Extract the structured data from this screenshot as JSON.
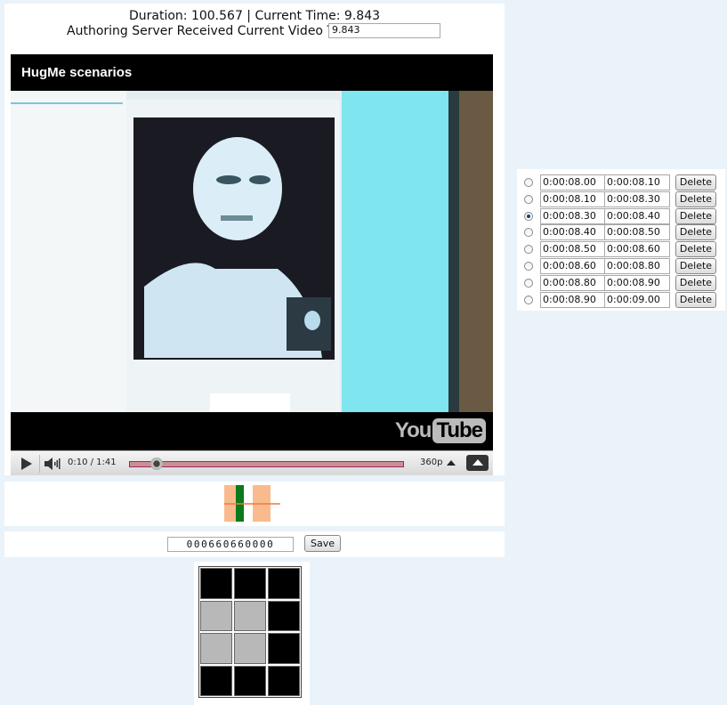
{
  "header": {
    "duration_line": "Duration: 100.567 | Current Time: 9.843",
    "received_label": "Authoring Server Received Current Video Time:",
    "received_value": "9.843"
  },
  "player": {
    "title": "HugMe scenarios",
    "logo_you": "You",
    "logo_tube": "Tube",
    "time_readout": "0:10 / 1:41",
    "quality": "360p",
    "progress": 0.1
  },
  "editor": {
    "code_value": "000660660000",
    "save_label": "Save"
  },
  "grid": {
    "cells": [
      "black",
      "black",
      "black",
      "gray",
      "gray",
      "black",
      "gray",
      "gray",
      "black",
      "black",
      "black",
      "black"
    ]
  },
  "segments": [
    {
      "start": "0:00:08.00",
      "end": "0:00:08.10",
      "selected": false,
      "delete_label": "Delete"
    },
    {
      "start": "0:00:08.10",
      "end": "0:00:08.30",
      "selected": false,
      "delete_label": "Delete"
    },
    {
      "start": "0:00:08.30",
      "end": "0:00:08.40",
      "selected": true,
      "delete_label": "Delete"
    },
    {
      "start": "0:00:08.40",
      "end": "0:00:08.50",
      "selected": false,
      "delete_label": "Delete"
    },
    {
      "start": "0:00:08.50",
      "end": "0:00:08.60",
      "selected": false,
      "delete_label": "Delete"
    },
    {
      "start": "0:00:08.60",
      "end": "0:00:08.80",
      "selected": false,
      "delete_label": "Delete"
    },
    {
      "start": "0:00:08.80",
      "end": "0:00:08.90",
      "selected": false,
      "delete_label": "Delete"
    },
    {
      "start": "0:00:08.90",
      "end": "0:00:09.00",
      "selected": false,
      "delete_label": "Delete"
    }
  ],
  "colors": {
    "timeline_block": "#f9bb8e",
    "timeline_marker": "#0a7a1a",
    "timeline_line": "#ef7a3a",
    "cell_black": "#000000",
    "cell_gray": "#b8b8b8",
    "progress": "#c89092"
  }
}
